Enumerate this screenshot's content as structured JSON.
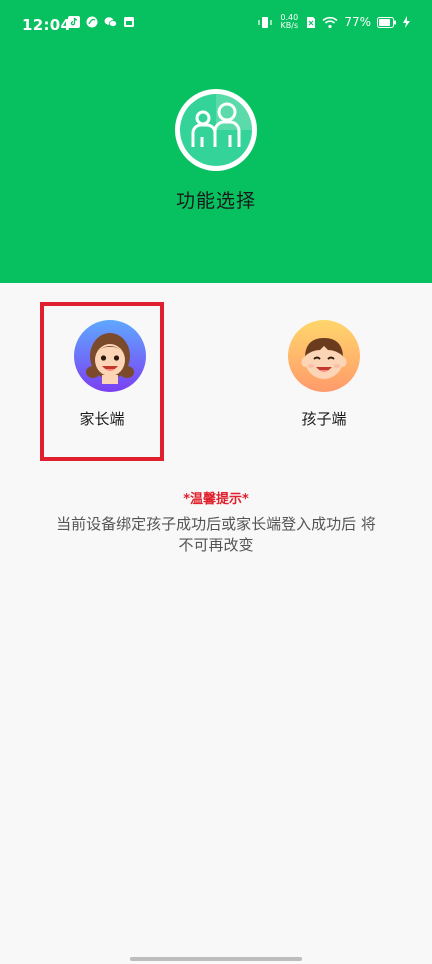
{
  "status_bar": {
    "time": "12:04",
    "net_speed_value": "0.40",
    "net_speed_unit": "KB/s",
    "battery": "77%"
  },
  "header": {
    "title": "功能选择",
    "logo_icon": "family-icon"
  },
  "roles": [
    {
      "label": "家长端",
      "icon": "parent-avatar-icon",
      "selected": true
    },
    {
      "label": "孩子端",
      "icon": "child-avatar-icon",
      "selected": false
    }
  ],
  "tip": {
    "title": "*温馨提示*",
    "body": "当前设备绑定孩子成功后或家长端登入成功后 将不可再改变"
  },
  "colors": {
    "brand_green": "#07c160",
    "highlight_red": "#e0202c",
    "tip_red": "#e0202c"
  }
}
